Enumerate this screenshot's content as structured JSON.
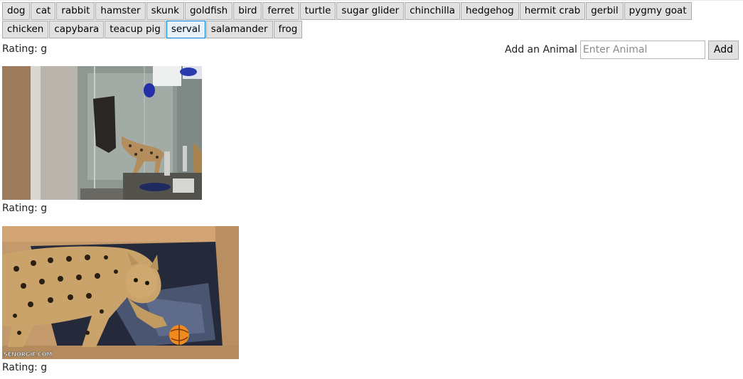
{
  "animals": [
    "dog",
    "cat",
    "rabbit",
    "hamster",
    "skunk",
    "goldfish",
    "bird",
    "ferret",
    "turtle",
    "sugar glider",
    "chinchilla",
    "hedgehog",
    "hermit crab",
    "gerbil",
    "pygmy goat",
    "chicken",
    "capybara",
    "teacup pig",
    "serval",
    "salamander",
    "frog"
  ],
  "selected_animal": "serval",
  "add_form": {
    "label": "Add an Animal",
    "placeholder": "Enter Animal",
    "button_label": "Add"
  },
  "results": [
    {
      "rating": "Rating: g"
    },
    {
      "rating": "Rating: g"
    },
    {
      "rating": "Rating: g"
    }
  ],
  "watermark": "SENORGIF.COM"
}
